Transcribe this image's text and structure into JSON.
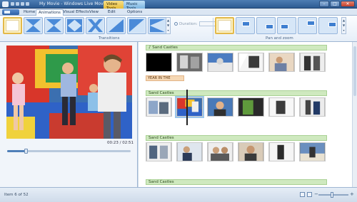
{
  "window": {
    "title": "My Movie - Windows Live Movie Maker",
    "context_tabs": [
      "Video Tools",
      "Music Tools"
    ]
  },
  "ribbon": {
    "tabs": [
      "Home",
      "Animations",
      "Visual Effects",
      "View",
      "Edit",
      "Options"
    ],
    "active_tab": "Animations",
    "groups": {
      "transitions": "Transitions",
      "pan_zoom": "Pan and zoom"
    },
    "duration_label": "Duration:"
  },
  "preview": {
    "timecode": "00:23 / 02:51",
    "progress": 0.15,
    "controls": {
      "prev": "◀❙",
      "play": "❙❙",
      "next": "❙▶"
    }
  },
  "storyboard": {
    "music_label": "Sand Castles",
    "caption_text": "YEAR IN THE",
    "rows": [
      {
        "music": "♪ Sand Castles"
      },
      {
        "music": "Sand Castles"
      },
      {
        "music": "Sand Castles"
      },
      {
        "music": "Sand Castles"
      }
    ]
  },
  "status": {
    "item_text": "Item 6 of 52",
    "zoom_level": 0.45
  },
  "colors": {
    "accent": "#2c5b92",
    "music_bar": "#cfe9bf",
    "caption": "#f6d8b5",
    "selection": "#e3b949"
  }
}
